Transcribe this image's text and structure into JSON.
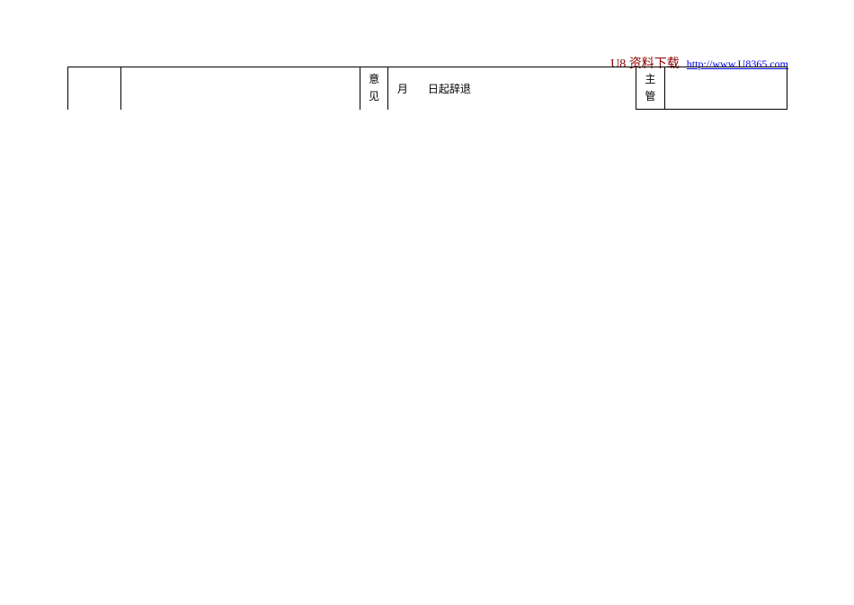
{
  "header": {
    "brand": "U8 资料下载",
    "link_text": "http://www.U8365.com"
  },
  "table": {
    "col_c_char1": "意",
    "col_c_char2": "见",
    "col_d_part1": "月",
    "col_d_part2": "日起辞退",
    "col_e_char1": "主",
    "col_e_char2": "管"
  }
}
